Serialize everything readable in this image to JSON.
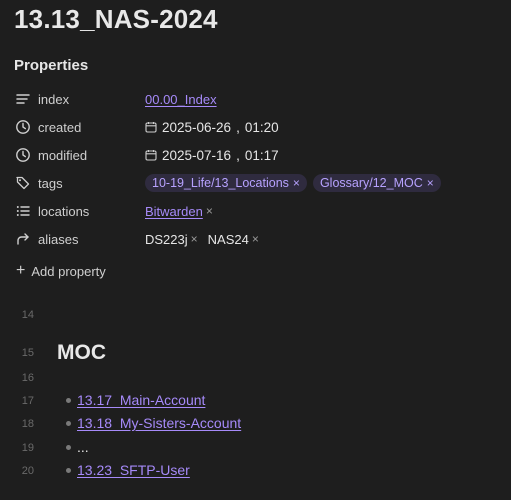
{
  "note": {
    "title": "13.13_NAS-2024"
  },
  "properties": {
    "heading": "Properties",
    "index": {
      "name": "index",
      "value": "00.00_Index"
    },
    "created": {
      "name": "created",
      "date": "2025-06-26",
      "time": "01:20"
    },
    "modified": {
      "name": "modified",
      "date": "2025-07-16",
      "time": "01:17"
    },
    "tags": {
      "name": "tags",
      "items": [
        "10-19_Life/13_Locations",
        "Glossary/12_MOC"
      ]
    },
    "locations": {
      "name": "locations",
      "items": [
        "Bitwarden"
      ]
    },
    "aliases": {
      "name": "aliases",
      "items": [
        "DS223j",
        "NAS24"
      ]
    },
    "add_label": "Add property",
    "remove_glyph": "×"
  },
  "editor": {
    "line_numbers": [
      "14",
      "15",
      "16",
      "17",
      "18",
      "19",
      "20"
    ],
    "heading": "MOC",
    "list": [
      "13.17_Main-Account",
      "13.18_My-Sisters-Account",
      "...",
      "13.23_SFTP-User"
    ]
  },
  "icons": {
    "index": "text-lines-icon",
    "created": "clock-icon",
    "modified": "clock-icon",
    "tags": "tags-icon",
    "locations": "list-icon",
    "aliases": "forward-arrow-icon",
    "date": "calendar-icon",
    "add": "plus-icon"
  },
  "colors": {
    "background": "#1e1e1e",
    "link": "#a68af9",
    "tag_bg": "#2f2b3f",
    "tag_text": "#b7a2ff"
  }
}
